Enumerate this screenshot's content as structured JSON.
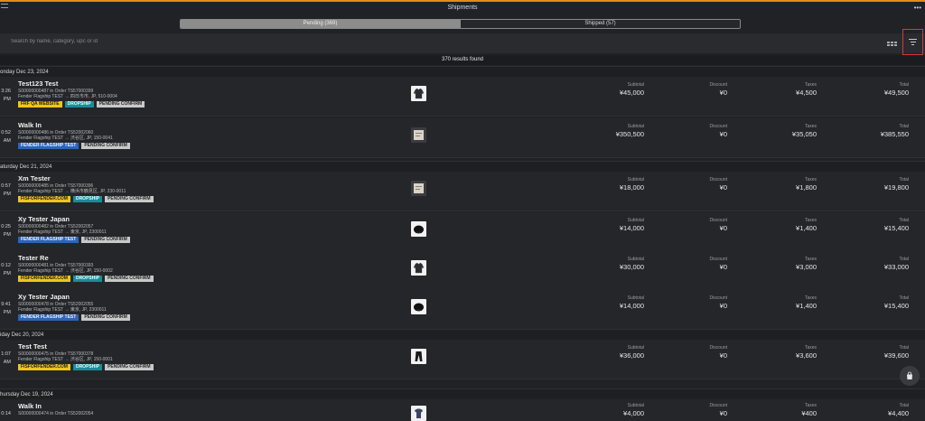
{
  "header": {
    "title": "Shipments"
  },
  "tabs": [
    {
      "label": "Pending (369)"
    },
    {
      "label": "Shipped (57)"
    }
  ],
  "search": {
    "placeholder": "Search by name, category, upc or id"
  },
  "results_text": "370 results found",
  "colors": {
    "accent": "#e58a1c",
    "filter_highlight": "#d23b3b",
    "tag_yellow": "#f0c419",
    "tag_teal": "#1a8d97",
    "tag_blue": "#2f64b5",
    "tag_gray": "#c8c8c8"
  },
  "groups": [
    {
      "date": "onday Dec 23, 2024",
      "rows": [
        {
          "time": "3:26",
          "ampm": "PM",
          "name": "Test123 Test",
          "line1": "S00000000487 in Order TS57000399",
          "line2": "Fender Flagship TEST → 四日市市, JP, 510-0004",
          "tags": [
            {
              "text": "FRF QA WEBSITE",
              "color": "yellow"
            },
            {
              "text": "DROPSHIP",
              "color": "teal"
            },
            {
              "text": "PENDING CONFIRM",
              "color": "gray"
            }
          ],
          "thumb": "jacket-image",
          "subtotal": "¥45,000",
          "discount": "¥0",
          "taxes": "¥4,500",
          "total": "¥49,500"
        },
        {
          "time": "0:52",
          "ampm": "AM",
          "name": "Walk In",
          "line1": "S00000000486 in Order TS52002060",
          "line2": "Fender Flagship TEST → 渋谷区, JP, 150-0041",
          "tags": [
            {
              "text": "FENDER FLAGSHIP TEST",
              "color": "blue"
            },
            {
              "text": "PENDING CONFIRM",
              "color": "gray"
            }
          ],
          "thumb": "product-image",
          "subtotal": "¥350,500",
          "discount": "¥0",
          "taxes": "¥35,050",
          "total": "¥385,550"
        }
      ]
    },
    {
      "date": "aturday Dec 21, 2024",
      "rows": [
        {
          "time": "0:57",
          "ampm": "PM",
          "name": "Xm Tester",
          "line1": "S00000000485 in Order TS57000396",
          "line2": "Fender Flagship TEST → 横浜市鶴見区, JP, 230-0011",
          "tags": [
            {
              "text": "FISFORFENDER.COM",
              "color": "yellow"
            },
            {
              "text": "DROPSHIP",
              "color": "teal"
            },
            {
              "text": "PENDING CONFIRM",
              "color": "gray"
            }
          ],
          "thumb": "product-image",
          "subtotal": "¥18,000",
          "discount": "¥0",
          "taxes": "¥1,800",
          "total": "¥19,800"
        },
        {
          "time": "0:25",
          "ampm": "PM",
          "name": "Xy Tester Japan",
          "line1": "S00000000482 in Order TS52002057",
          "line2": "Fender Flagship TEST → 東京, JP, 2300011",
          "tags": [
            {
              "text": "FENDER FLAGSHIP TEST",
              "color": "blue"
            },
            {
              "text": "PENDING CONFIRM",
              "color": "gray"
            }
          ],
          "thumb": "cap-image",
          "subtotal": "¥14,000",
          "discount": "¥0",
          "taxes": "¥1,400",
          "total": "¥15,400"
        },
        {
          "time": "0:12",
          "ampm": "PM",
          "name": "Tester Re",
          "line1": "S00000000481 in Order TS57000393",
          "line2": "Fender Flagship TEST → 渋谷区, JP, 150-0002",
          "tags": [
            {
              "text": "FISFORFENDER.COM",
              "color": "yellow"
            },
            {
              "text": "DROPSHIP",
              "color": "teal"
            },
            {
              "text": "PENDING CONFIRM",
              "color": "gray"
            }
          ],
          "thumb": "jacket-image",
          "subtotal": "¥30,000",
          "discount": "¥0",
          "taxes": "¥3,000",
          "total": "¥33,000"
        },
        {
          "time": "9:41",
          "ampm": "PM",
          "name": "Xy Tester Japan",
          "line1": "S00000000478 in Order TS52002055",
          "line2": "Fender Flagship TEST → 東京, JP, 2300011",
          "tags": [
            {
              "text": "FENDER FLAGSHIP TEST",
              "color": "blue"
            },
            {
              "text": "PENDING CONFIRM",
              "color": "gray"
            }
          ],
          "thumb": "cap-image",
          "subtotal": "¥14,000",
          "discount": "¥0",
          "taxes": "¥1,400",
          "total": "¥15,400"
        }
      ]
    },
    {
      "date": "iday Dec 20, 2024",
      "rows": [
        {
          "time": "1:07",
          "ampm": "AM",
          "name": "Test Test",
          "line1": "S00000000475 in Order TS57000378",
          "line2": "Fender Flagship TEST → 渋谷区, JP, 150-0001",
          "tags": [
            {
              "text": "FISFORFENDER.COM",
              "color": "yellow"
            },
            {
              "text": "DROPSHIP",
              "color": "teal"
            },
            {
              "text": "PENDING CONFIRM",
              "color": "gray"
            }
          ],
          "thumb": "pants-image",
          "subtotal": "¥36,000",
          "discount": "¥0",
          "taxes": "¥3,600",
          "total": "¥39,600"
        }
      ]
    },
    {
      "date": "hursday Dec 19, 2024",
      "rows": [
        {
          "time": "0:14",
          "ampm": "",
          "name": "Walk In",
          "line1": "S00000000474 in Order TS52002054",
          "line2": "",
          "tags": [],
          "thumb": "tshirt-image",
          "subtotal": "¥4,000",
          "discount": "¥0",
          "taxes": "¥400",
          "total": "¥4,400"
        }
      ]
    }
  ],
  "labels": {
    "subtotal": "Subtotal",
    "discount": "Discount",
    "taxes": "Taxes",
    "total": "Total"
  }
}
